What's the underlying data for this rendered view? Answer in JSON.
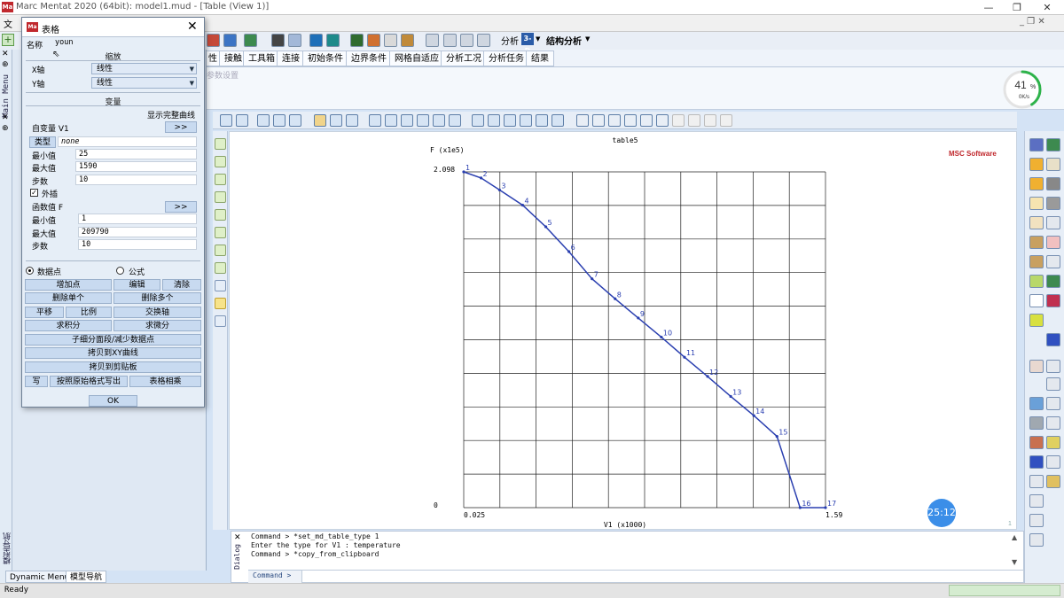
{
  "window": {
    "title": "Marc Mentat 2020 (64bit): model1.mud - [Table (View 1)]",
    "app_icon": "Ma",
    "min": "—",
    "restore": "❐",
    "close": "✕"
  },
  "menubar": {
    "first": "文"
  },
  "toolbar": {
    "analysis_label": "分析",
    "mode_label": "3-D",
    "structural_label": "结构分析"
  },
  "tabs": [
    "性",
    "接触",
    "工具箱",
    "连接",
    "初始条件",
    "边界条件",
    "网格自适应",
    "分析工况",
    "分析任务",
    "结果"
  ],
  "ribbon": {
    "faded_label": "参数设置"
  },
  "gauge": {
    "percent": "41",
    "unit": "%",
    "speed": "0K/s",
    "fraction": 0.41
  },
  "left_strip": {
    "main_menu": "Main Menu",
    "model_nav": "模型导航"
  },
  "dialog_table": {
    "icon": "Ma",
    "title": "表格",
    "name_label": "名称",
    "name_value": "youn",
    "scale_section": "缩放",
    "x_axis_label": "X轴",
    "x_axis_value": "线性",
    "y_axis_label": "Y轴",
    "y_axis_value": "线性",
    "variables_section": "变量",
    "show_full_curve": "显示完整曲线",
    "indep_label": "自变量 V1",
    "more_button": ">>",
    "type_button": "类型",
    "type_value": "none",
    "min_label": "最小值",
    "min_value": "25",
    "max_label": "最大值",
    "max_value": "1590",
    "steps_label": "步数",
    "steps_value": "10",
    "extrapolate_label": "外插",
    "func_label": "函数值 F",
    "fmin_label": "最小值",
    "fmin_value": "1",
    "fmax_label": "最大值",
    "fmax_value": "209790",
    "fsteps_label": "步数",
    "fsteps_value": "10",
    "radio_data_points": "数据点",
    "radio_formula": "公式",
    "btn_add_points": "增加点",
    "btn_edit": "编辑",
    "btn_clear": "清除",
    "btn_remove_one": "删除单个",
    "btn_remove_many": "删除多个",
    "btn_translate": "平移",
    "btn_scale": "比例",
    "btn_swap_axes": "交换轴",
    "btn_integrate": "求积分",
    "btn_differentiate": "求微分",
    "btn_subdivide": "子细分面段/减少数据点",
    "btn_copy_xy": "拷贝到XY曲线",
    "btn_copy_clipboard": "拷贝到剪贴板",
    "btn_write": "写",
    "btn_write_raw": "按照原始格式写出",
    "btn_table_multiply": "表格相乘",
    "btn_ok": "OK"
  },
  "chart_data": {
    "type": "line",
    "title": "table5",
    "ylabel": "F (x1e5)",
    "xlabel": "V1 (x1000)",
    "xlim": [
      0.025,
      1.59
    ],
    "ylim": [
      0,
      2.098
    ],
    "x_tick_labels": [
      "0.025",
      "1.59"
    ],
    "y_tick_labels": [
      "0",
      "2.098"
    ],
    "grid": true,
    "brand_label": "MSC Software",
    "page_number": "1",
    "series": [
      {
        "color": "#2a3fb0",
        "points": [
          {
            "label": "1",
            "x": 0.025,
            "y": 2.098
          },
          {
            "label": "2",
            "x": 0.1,
            "y": 2.06
          },
          {
            "label": "3",
            "x": 0.18,
            "y": 1.985
          },
          {
            "label": "4",
            "x": 0.28,
            "y": 1.89
          },
          {
            "label": "5",
            "x": 0.38,
            "y": 1.755
          },
          {
            "label": "6",
            "x": 0.48,
            "y": 1.6
          },
          {
            "label": "7",
            "x": 0.58,
            "y": 1.43
          },
          {
            "label": "8",
            "x": 0.68,
            "y": 1.305
          },
          {
            "label": "9",
            "x": 0.78,
            "y": 1.185
          },
          {
            "label": "10",
            "x": 0.88,
            "y": 1.065
          },
          {
            "label": "11",
            "x": 0.98,
            "y": 0.94
          },
          {
            "label": "12",
            "x": 1.08,
            "y": 0.82
          },
          {
            "label": "13",
            "x": 1.18,
            "y": 0.695
          },
          {
            "label": "14",
            "x": 1.28,
            "y": 0.575
          },
          {
            "label": "15",
            "x": 1.38,
            "y": 0.445
          },
          {
            "label": "16",
            "x": 1.48,
            "y": 0.0
          },
          {
            "label": "17",
            "x": 1.59,
            "y": 0.0
          }
        ]
      }
    ]
  },
  "dialog_console": {
    "label": "Dialog",
    "lines": [
      "Command > *set_md_table_type 1",
      "Enter the type for V1 : temperature",
      "Command > *copy_from_clipboard"
    ],
    "command_label": "Command >"
  },
  "bottom_tabs": [
    "Dynamic Menu",
    "模型导航"
  ],
  "status": {
    "text": "Ready"
  },
  "timer": "25:12"
}
